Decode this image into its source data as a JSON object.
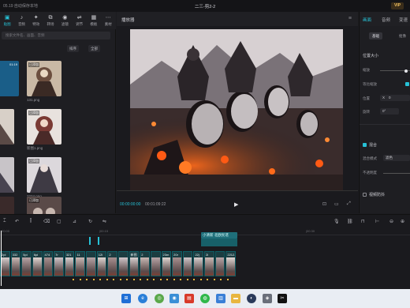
{
  "titlebar": {
    "left_text": "05.19 自动保存本地",
    "title": "二三-剪2-2",
    "vip_label": "VIP"
  },
  "media_panel": {
    "tools": [
      {
        "icon": "media-icon",
        "label": "贴图"
      },
      {
        "icon": "audio-icon",
        "label": "音频"
      },
      {
        "icon": "text-icon",
        "label": "特效"
      },
      {
        "icon": "sticker-icon",
        "label": "转场"
      },
      {
        "icon": "effects-icon",
        "label": "滤镜"
      },
      {
        "icon": "transition-icon",
        "label": "调节"
      },
      {
        "icon": "template-icon",
        "label": "模板"
      },
      {
        "icon": "more-icon",
        "label": "素材"
      }
    ],
    "search_placeholder": "搜索文件名、画面、音频",
    "sort_label": "排序",
    "filter_label": "全部",
    "items": [
      {
        "tag": "",
        "duration": "01:19",
        "caption": ""
      },
      {
        "tag": "已添加",
        "duration": "",
        "caption": "131.png"
      },
      {
        "tag": "",
        "duration": "",
        "caption": ""
      },
      {
        "tag": "已添加",
        "duration": "",
        "caption": "新图1.png"
      },
      {
        "tag": "",
        "duration": "",
        "caption": ""
      },
      {
        "tag": "已添加",
        "duration": "",
        "caption": "2224.png"
      },
      {
        "tag": "",
        "duration": "",
        "caption": ""
      },
      {
        "tag": "已添加",
        "duration": "",
        "caption": ""
      }
    ]
  },
  "player": {
    "title": "播放器",
    "current_time": "00:00:00:00",
    "total_time": "00:01:09:22"
  },
  "props": {
    "tabs": [
      "画面",
      "音频",
      "变速"
    ],
    "subtabs": [
      "基础",
      "抠像"
    ],
    "section_position": "位置大小",
    "label_scale": "缩放",
    "label_uniform": "等比缩放",
    "label_position": "位置",
    "label_rotate": "旋转",
    "position_x_label": "X",
    "position_x_value": "0",
    "rotate_value": "0°",
    "section_blend": "混合",
    "label_blend_mode": "混合模式",
    "blend_mode_value": "滤色",
    "label_opacity": "不透明度",
    "section_stabilize": "视频防抖",
    "scale_level": 0.85
  },
  "timeline": {
    "ruler_labels": [
      "00:00",
      "|00:15",
      "|00:30"
    ],
    "audio_clip_label": "小清新 北欧民谣",
    "clips": [
      "2pi",
      "332",
      "5pi",
      "6pi",
      "474",
      "7r",
      "321",
      "11",
      "",
      "12i",
      "2",
      "",
      "新图",
      "2",
      "",
      "23m",
      "20r",
      "",
      "22j",
      "2i",
      "",
      "2212.pn"
    ]
  },
  "colors": {
    "accent": "#27c1d6",
    "clip_border": "#0d5f66",
    "keyframe": "#e8b640"
  }
}
